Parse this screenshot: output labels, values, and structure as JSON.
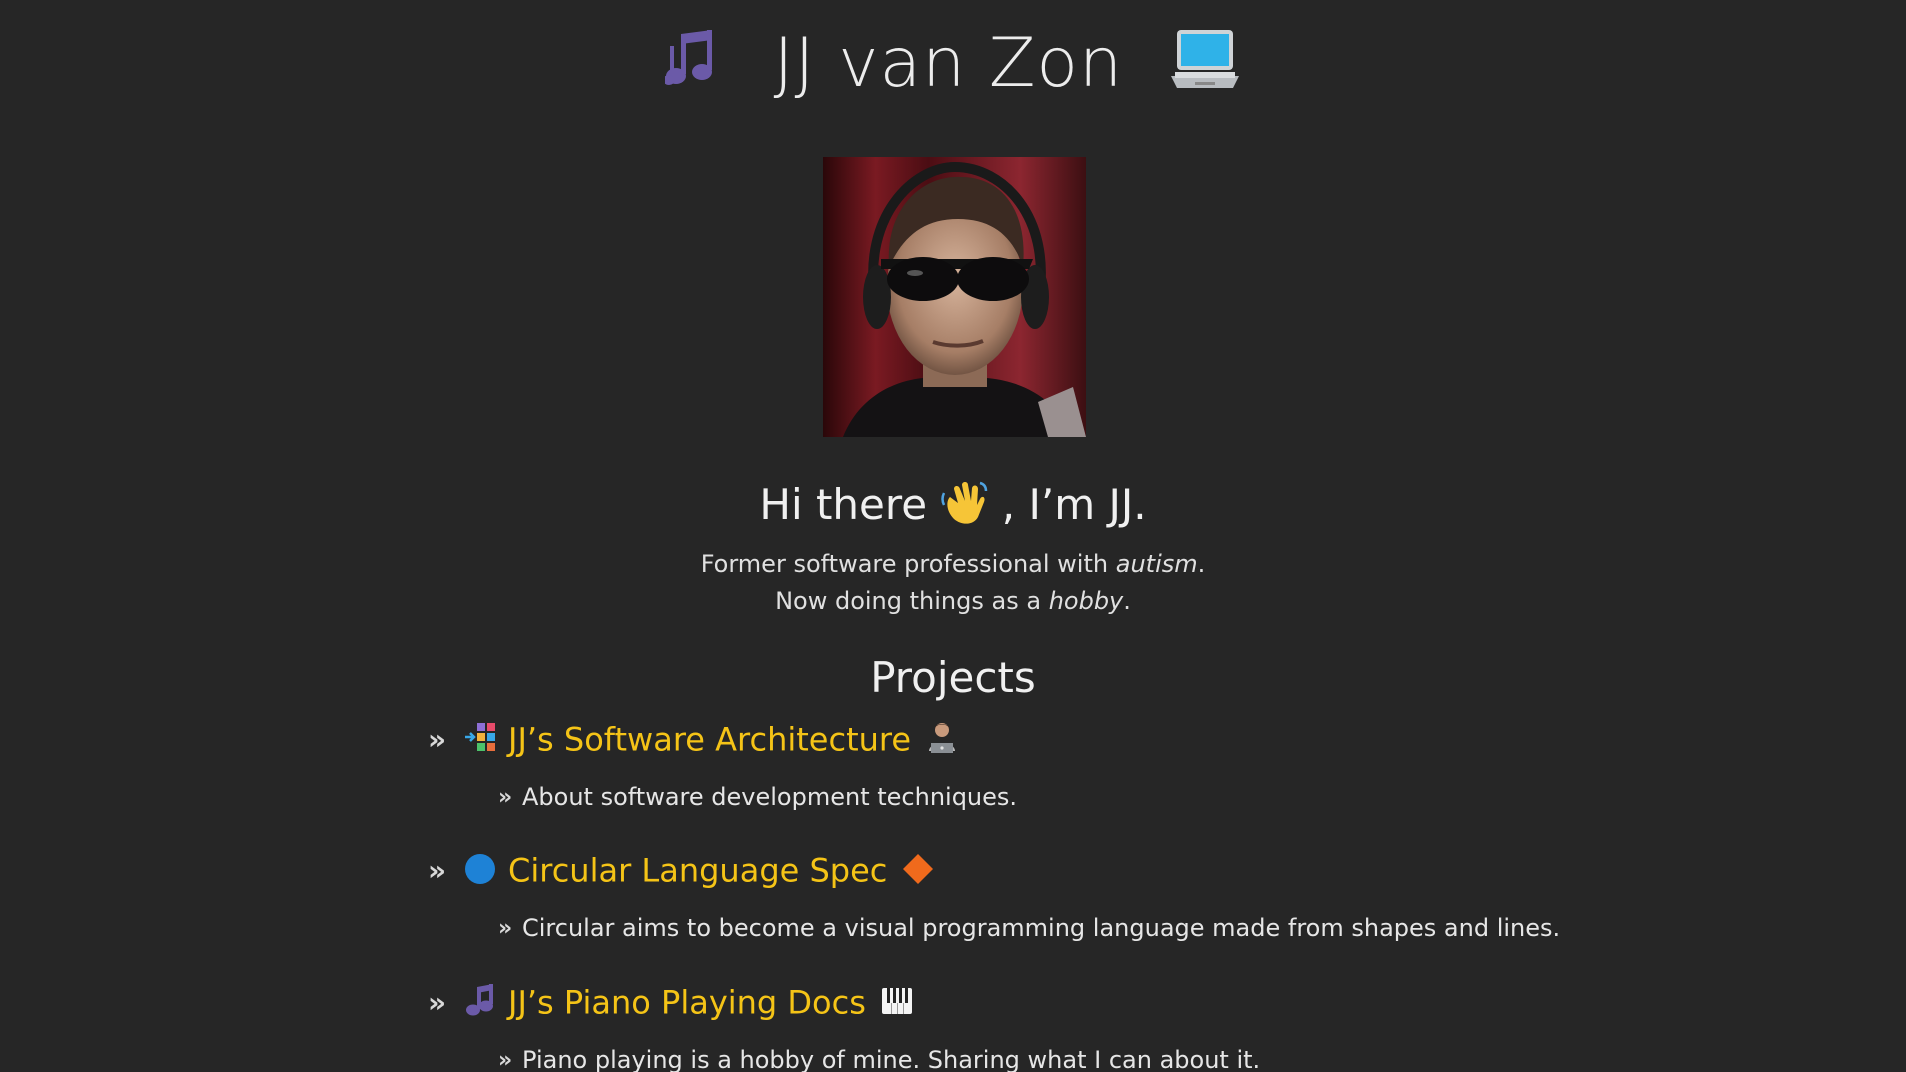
{
  "header": {
    "title": "JJ van Zon",
    "leading_icon": "music-notes-icon",
    "trailing_icon": "laptop-icon"
  },
  "avatar": {
    "alt": "Portrait photo of JJ wearing sunglasses and headphones"
  },
  "intro": {
    "greeting_before": "Hi there",
    "greeting_after": ", I’m JJ.",
    "line1_before": "Former software professional with ",
    "line1_em": "autism",
    "line1_after": ".",
    "line2_before": "Now doing things as a ",
    "line2_em": "hobby",
    "line2_after": "."
  },
  "projects": {
    "heading": "Projects",
    "items": [
      {
        "icon": "blocks-icon",
        "title": "JJ’s Software Architecture",
        "icon_after": "technologist-icon",
        "description": "About software development techniques."
      },
      {
        "icon": "blue-circle-icon",
        "title": "Circular Language Spec",
        "icon_after": "orange-diamond-icon",
        "description": "Circular aims to become a visual programming language made from shapes and lines."
      },
      {
        "icon": "music-note-icon",
        "title": "JJ’s Piano Playing Docs",
        "icon_after": "piano-keys-icon",
        "description": "Piano playing is a hobby of mine. Sharing what I can about it."
      }
    ]
  },
  "colors": {
    "background": "#262626",
    "link": "#f5c417",
    "text": "#e8e8e8"
  }
}
